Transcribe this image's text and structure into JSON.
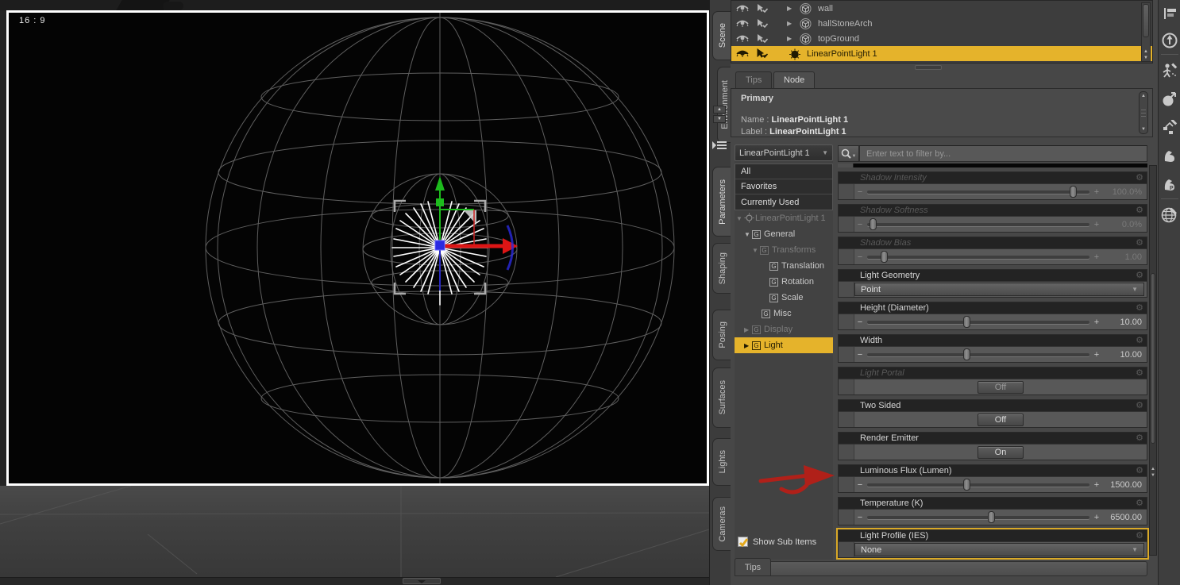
{
  "viewport": {
    "aspect_label": "16 : 9"
  },
  "left_tabs": {
    "scene": "Scene",
    "environment": "Environment",
    "parameters": "Parameters",
    "shaping": "Shaping",
    "posing": "Posing",
    "surfaces": "Surfaces",
    "lights": "Lights",
    "cameras": "Cameras"
  },
  "scene_panel": {
    "items": [
      {
        "label": "wall"
      },
      {
        "label": "hallStoneArch"
      },
      {
        "label": "topGround"
      },
      {
        "label": "LinearPointLight 1"
      }
    ]
  },
  "node_panel": {
    "tab_tips": "Tips",
    "tab_node": "Node",
    "section_title": "Primary",
    "name_label": "Name :",
    "name_value": "LinearPointLight 1",
    "label_label": "Label :",
    "label_value": "LinearPointLight 1"
  },
  "parameters": {
    "selector": "LinearPointLight 1",
    "filters": [
      "All",
      "Favorites",
      "Currently Used"
    ],
    "tree": [
      {
        "label": "LinearPointLight 1"
      },
      {
        "label": "General"
      },
      {
        "label": "Transforms"
      },
      {
        "label": "Translation"
      },
      {
        "label": "Rotation"
      },
      {
        "label": "Scale"
      },
      {
        "label": "Misc"
      },
      {
        "label": "Display"
      },
      {
        "label": "Light"
      }
    ],
    "show_sub_items": "Show Sub Items",
    "search_placeholder": "Enter text to filter by...",
    "params": [
      {
        "name": "Shadow Intensity",
        "value": "100.0%"
      },
      {
        "name": "Shadow Softness",
        "value": "0.0%"
      },
      {
        "name": "Shadow Bias",
        "value": "1.00"
      },
      {
        "name": "Light Geometry",
        "value": "Point"
      },
      {
        "name": "Height (Diameter)",
        "value": "10.00"
      },
      {
        "name": "Width",
        "value": "10.00"
      },
      {
        "name": "Light Portal",
        "value": "Off"
      },
      {
        "name": "Two Sided",
        "value": "Off"
      },
      {
        "name": "Render Emitter",
        "value": "On"
      },
      {
        "name": "Luminous Flux (Lumen)",
        "value": "1500.00"
      },
      {
        "name": "Temperature (K)",
        "value": "6500.00"
      },
      {
        "name": "Light Profile (IES)",
        "value": "None"
      }
    ]
  },
  "tips_bar": {
    "label": "Tips"
  },
  "icons": {
    "gear": "⚙",
    "caret_down": "▼",
    "caret_right": "▶",
    "dropdown_arrow": "▼",
    "up_small": "▲",
    "down_small": "▼",
    "minus": "−",
    "plus": "+",
    "group_letter": "G"
  },
  "colors": {
    "selection_yellow": "#e5b32b",
    "highlight_border": "#d9a928",
    "annotation_red": "#b02019",
    "axis_green": "#1dbb1d",
    "axis_red": "#dd1515",
    "axis_blue": "#2a2ae0"
  }
}
